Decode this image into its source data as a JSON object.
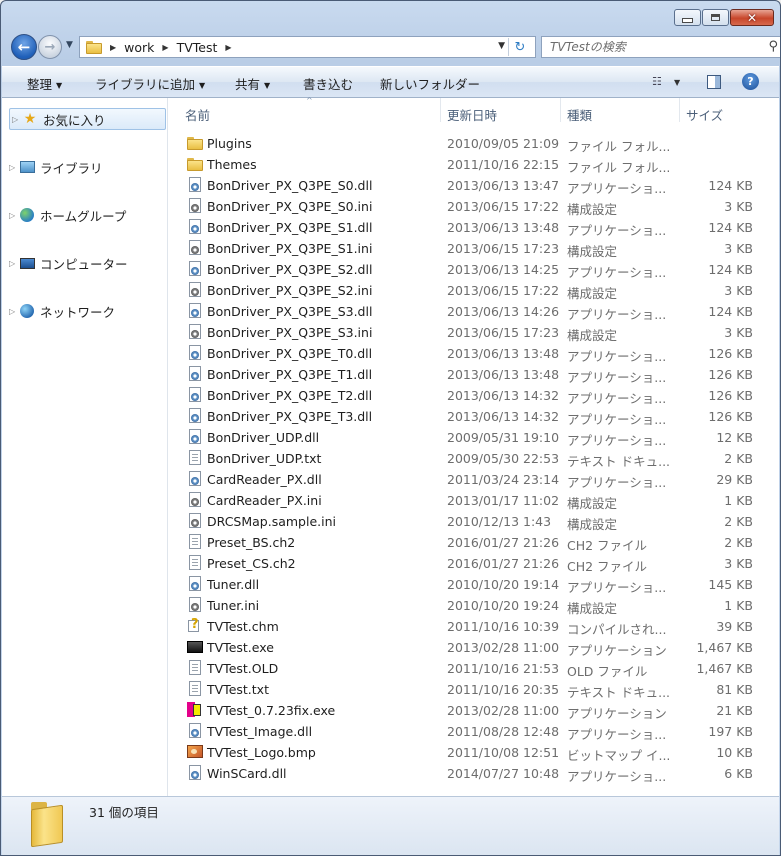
{
  "window": {
    "caption_close": "✕"
  },
  "nav": {
    "breadcrumb": [
      "work",
      "TVTest"
    ],
    "search_placeholder": "TVTestの検索"
  },
  "toolbar": {
    "organize": "整理",
    "add_to_library": "ライブラリに追加",
    "share": "共有",
    "burn": "書き込む",
    "new_folder": "新しいフォルダー"
  },
  "sidebar": {
    "items": [
      {
        "label": "お気に入り",
        "icon": "star-icon"
      },
      {
        "label": "ライブラリ",
        "icon": "library-icon"
      },
      {
        "label": "ホームグループ",
        "icon": "homegroup-icon"
      },
      {
        "label": "コンピューター",
        "icon": "computer-icon"
      },
      {
        "label": "ネットワーク",
        "icon": "network-icon"
      }
    ]
  },
  "columns": {
    "name": "名前",
    "date": "更新日時",
    "type": "種類",
    "size": "サイズ"
  },
  "files": [
    {
      "name": "Plugins",
      "date": "2010/09/05 21:09",
      "type": "ファイル フォル...",
      "size": "",
      "icon": "folder"
    },
    {
      "name": "Themes",
      "date": "2011/10/16 22:15",
      "type": "ファイル フォル...",
      "size": "",
      "icon": "folder"
    },
    {
      "name": "BonDriver_PX_Q3PE_S0.dll",
      "date": "2013/06/13 13:47",
      "type": "アプリケーショ...",
      "size": "124 KB",
      "icon": "dll"
    },
    {
      "name": "BonDriver_PX_Q3PE_S0.ini",
      "date": "2013/06/15 17:22",
      "type": "構成設定",
      "size": "3 KB",
      "icon": "ini"
    },
    {
      "name": "BonDriver_PX_Q3PE_S1.dll",
      "date": "2013/06/13 13:48",
      "type": "アプリケーショ...",
      "size": "124 KB",
      "icon": "dll"
    },
    {
      "name": "BonDriver_PX_Q3PE_S1.ini",
      "date": "2013/06/15 17:23",
      "type": "構成設定",
      "size": "3 KB",
      "icon": "ini"
    },
    {
      "name": "BonDriver_PX_Q3PE_S2.dll",
      "date": "2013/06/13 14:25",
      "type": "アプリケーショ...",
      "size": "124 KB",
      "icon": "dll"
    },
    {
      "name": "BonDriver_PX_Q3PE_S2.ini",
      "date": "2013/06/15 17:22",
      "type": "構成設定",
      "size": "3 KB",
      "icon": "ini"
    },
    {
      "name": "BonDriver_PX_Q3PE_S3.dll",
      "date": "2013/06/13 14:26",
      "type": "アプリケーショ...",
      "size": "124 KB",
      "icon": "dll"
    },
    {
      "name": "BonDriver_PX_Q3PE_S3.ini",
      "date": "2013/06/15 17:23",
      "type": "構成設定",
      "size": "3 KB",
      "icon": "ini"
    },
    {
      "name": "BonDriver_PX_Q3PE_T0.dll",
      "date": "2013/06/13 13:48",
      "type": "アプリケーショ...",
      "size": "126 KB",
      "icon": "dll"
    },
    {
      "name": "BonDriver_PX_Q3PE_T1.dll",
      "date": "2013/06/13 13:48",
      "type": "アプリケーショ...",
      "size": "126 KB",
      "icon": "dll"
    },
    {
      "name": "BonDriver_PX_Q3PE_T2.dll",
      "date": "2013/06/13 14:32",
      "type": "アプリケーショ...",
      "size": "126 KB",
      "icon": "dll"
    },
    {
      "name": "BonDriver_PX_Q3PE_T3.dll",
      "date": "2013/06/13 14:32",
      "type": "アプリケーショ...",
      "size": "126 KB",
      "icon": "dll"
    },
    {
      "name": "BonDriver_UDP.dll",
      "date": "2009/05/31 19:10",
      "type": "アプリケーショ...",
      "size": "12 KB",
      "icon": "dll"
    },
    {
      "name": "BonDriver_UDP.txt",
      "date": "2009/05/30 22:53",
      "type": "テキスト ドキュ...",
      "size": "2 KB",
      "icon": "doc"
    },
    {
      "name": "CardReader_PX.dll",
      "date": "2011/03/24 23:14",
      "type": "アプリケーショ...",
      "size": "29 KB",
      "icon": "dll"
    },
    {
      "name": "CardReader_PX.ini",
      "date": "2013/01/17 11:02",
      "type": "構成設定",
      "size": "1 KB",
      "icon": "ini"
    },
    {
      "name": "DRCSMap.sample.ini",
      "date": "2010/12/13 1:43",
      "type": "構成設定",
      "size": "2 KB",
      "icon": "ini"
    },
    {
      "name": "Preset_BS.ch2",
      "date": "2016/01/27 21:26",
      "type": "CH2 ファイル",
      "size": "2 KB",
      "icon": "doc"
    },
    {
      "name": "Preset_CS.ch2",
      "date": "2016/01/27 21:26",
      "type": "CH2 ファイル",
      "size": "3 KB",
      "icon": "doc"
    },
    {
      "name": "Tuner.dll",
      "date": "2010/10/20 19:14",
      "type": "アプリケーショ...",
      "size": "145 KB",
      "icon": "dll"
    },
    {
      "name": "Tuner.ini",
      "date": "2010/10/20 19:24",
      "type": "構成設定",
      "size": "1 KB",
      "icon": "ini"
    },
    {
      "name": "TVTest.chm",
      "date": "2011/10/16 10:39",
      "type": "コンパイルされ...",
      "size": "39 KB",
      "icon": "chm"
    },
    {
      "name": "TVTest.exe",
      "date": "2013/02/28 11:00",
      "type": "アプリケーション",
      "size": "1,467 KB",
      "icon": "exe"
    },
    {
      "name": "TVTest.OLD",
      "date": "2011/10/16 21:53",
      "type": "OLD ファイル",
      "size": "1,467 KB",
      "icon": "doc"
    },
    {
      "name": "TVTest.txt",
      "date": "2011/10/16 20:35",
      "type": "テキスト ドキュ...",
      "size": "81 KB",
      "icon": "doc"
    },
    {
      "name": "TVTest_0.7.23fix.exe",
      "date": "2013/02/28 11:00",
      "type": "アプリケーション",
      "size": "21 KB",
      "icon": "fix"
    },
    {
      "name": "TVTest_Image.dll",
      "date": "2011/08/28 12:48",
      "type": "アプリケーショ...",
      "size": "197 KB",
      "icon": "dll"
    },
    {
      "name": "TVTest_Logo.bmp",
      "date": "2011/10/08 12:51",
      "type": "ビットマップ イ...",
      "size": "10 KB",
      "icon": "bmp"
    },
    {
      "name": "WinSCard.dll",
      "date": "2014/07/27 10:48",
      "type": "アプリケーショ...",
      "size": "6 KB",
      "icon": "dll"
    }
  ],
  "status": {
    "item_count": "31 個の項目"
  }
}
